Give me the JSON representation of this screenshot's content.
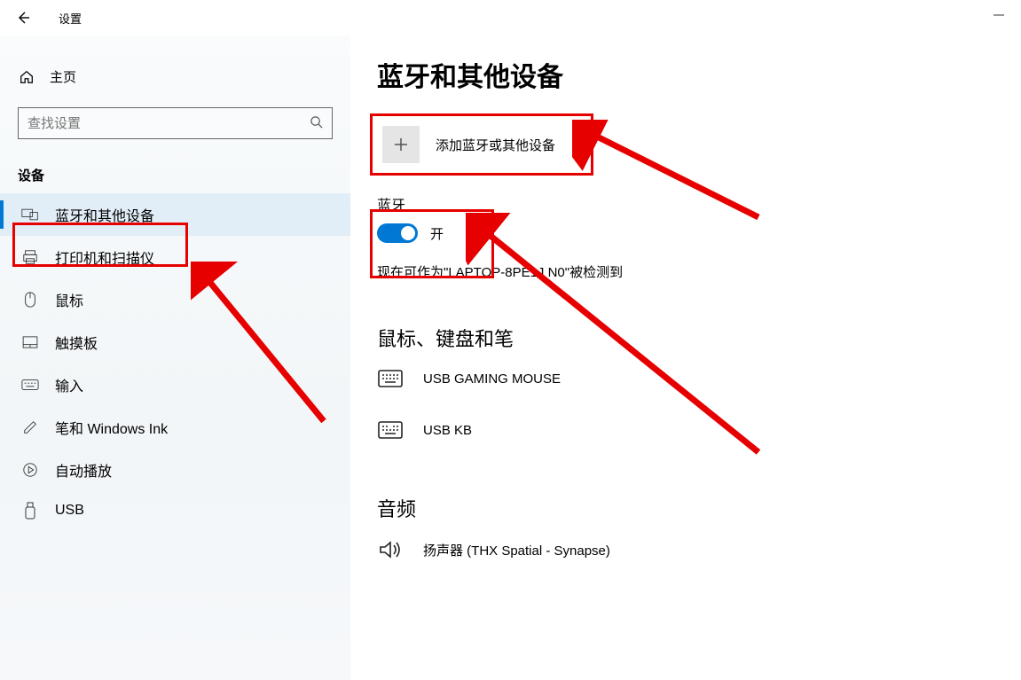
{
  "window": {
    "title": "设置"
  },
  "sidebar": {
    "home_label": "主页",
    "search_placeholder": "查找设置",
    "section_label": "设备",
    "items": [
      {
        "label": "蓝牙和其他设备",
        "active": true
      },
      {
        "label": "打印机和扫描仪"
      },
      {
        "label": "鼠标"
      },
      {
        "label": "触摸板"
      },
      {
        "label": "输入"
      },
      {
        "label": "笔和 Windows Ink"
      },
      {
        "label": "自动播放"
      },
      {
        "label": "USB"
      }
    ]
  },
  "main": {
    "title": "蓝牙和其他设备",
    "add_device_label": "添加蓝牙或其他设备",
    "bluetooth_heading": "蓝牙",
    "bluetooth_state": "开",
    "discoverable_text": "现在可作为\"LAPTOP-8PE1J   N0\"被检测到",
    "group_input_title": "鼠标、键盘和笔",
    "devices_input": [
      {
        "name": "USB GAMING MOUSE"
      },
      {
        "name": "USB KB"
      }
    ],
    "group_audio_title": "音频",
    "devices_audio": [
      {
        "name": "扬声器 (THX Spatial - Synapse)"
      }
    ]
  }
}
